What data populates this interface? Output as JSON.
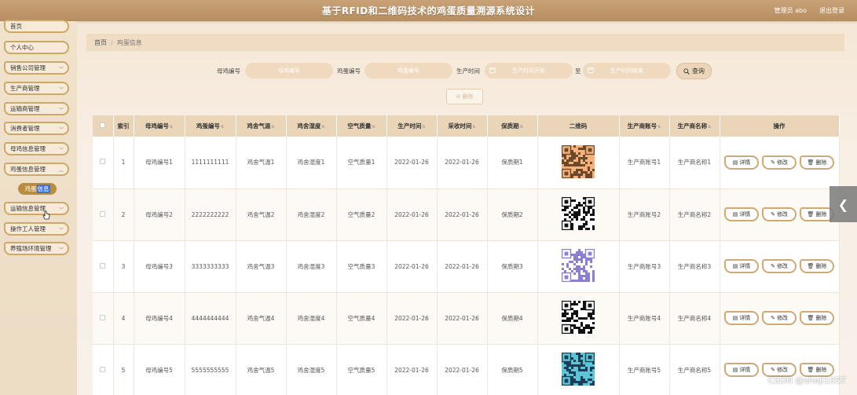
{
  "header": {
    "title": "基于RFID和二维码技术的鸡蛋质量溯源系统设计",
    "admin_label": "管理员 abo",
    "logout_label": "退出登录"
  },
  "sidebar": {
    "items": [
      {
        "label": "首页"
      },
      {
        "label": "个人中心"
      },
      {
        "label": "销售公司管理"
      },
      {
        "label": "生产商管理"
      },
      {
        "label": "运输商管理"
      },
      {
        "label": "消费者管理"
      },
      {
        "label": "母鸡信息管理"
      },
      {
        "label": "鸡蛋信息管理"
      },
      {
        "label": "运输信息管理"
      },
      {
        "label": "操作工人管理"
      },
      {
        "label": "养殖场环境管理"
      }
    ],
    "sub_item": {
      "label_a": "鸡蛋",
      "label_b": "信息"
    }
  },
  "breadcrumb": {
    "home": "首页",
    "sep": "/",
    "current": "鸡蛋信息"
  },
  "search": {
    "hen_label": "母鸡编号",
    "hen_placeholder": "母鸡编号",
    "egg_label": "鸡蛋编号",
    "egg_placeholder": "鸡蛋编号",
    "time_label": "生产时间",
    "start_placeholder": "生产时间开始",
    "to_label": "至",
    "end_placeholder": "生产时间结束",
    "query_label": "查询",
    "delete_label": "删除"
  },
  "table": {
    "headers": [
      "索引",
      "母鸡编号",
      "鸡蛋编号",
      "鸡舍气温",
      "鸡舍湿度",
      "空气质量",
      "生产时间",
      "采收时间",
      "保质期",
      "二维码",
      "生产商账号",
      "生产商名称",
      "操作"
    ],
    "actions": {
      "detail": "详情",
      "edit": "修改",
      "delete": "删除"
    },
    "rows": [
      {
        "idx": "1",
        "hen": "母鸡编号1",
        "egg": "1111111111",
        "temp": "鸡舍气温1",
        "hum": "鸡舍湿度1",
        "air": "空气质量1",
        "prod": "2022-01-26",
        "harv": "2022-01-26",
        "shelf": "保质期1",
        "acct": "生产商账号1",
        "name": "生产商名称1"
      },
      {
        "idx": "2",
        "hen": "母鸡编号2",
        "egg": "2222222222",
        "temp": "鸡舍气温2",
        "hum": "鸡舍湿度2",
        "air": "空气质量2",
        "prod": "2022-01-26",
        "harv": "2022-01-26",
        "shelf": "保质期2",
        "acct": "生产商账号2",
        "name": "生产商名称2"
      },
      {
        "idx": "3",
        "hen": "母鸡编号3",
        "egg": "3333333333",
        "temp": "鸡舍气温3",
        "hum": "鸡舍湿度3",
        "air": "空气质量3",
        "prod": "2022-01-26",
        "harv": "2022-01-26",
        "shelf": "保质期3",
        "acct": "生产商账号3",
        "name": "生产商名称3"
      },
      {
        "idx": "4",
        "hen": "母鸡编号4",
        "egg": "4444444444",
        "temp": "鸡舍气温4",
        "hum": "鸡舍湿度4",
        "air": "空气质量4",
        "prod": "2022-01-26",
        "harv": "2022-01-26",
        "shelf": "保质期4",
        "acct": "生产商账号4",
        "name": "生产商名称4"
      },
      {
        "idx": "5",
        "hen": "母鸡编号5",
        "egg": "5555555555",
        "temp": "鸡舍气温5",
        "hum": "鸡舍湿度5",
        "air": "空气质量5",
        "prod": "2022-01-26",
        "harv": "2022-01-26",
        "shelf": "保质期5",
        "acct": "生产商账号5",
        "name": "生产商名称5"
      }
    ]
  },
  "watermark": "CSDN @sheji1057",
  "colors": {
    "accent": "#cca968",
    "header": "#b58d60"
  }
}
